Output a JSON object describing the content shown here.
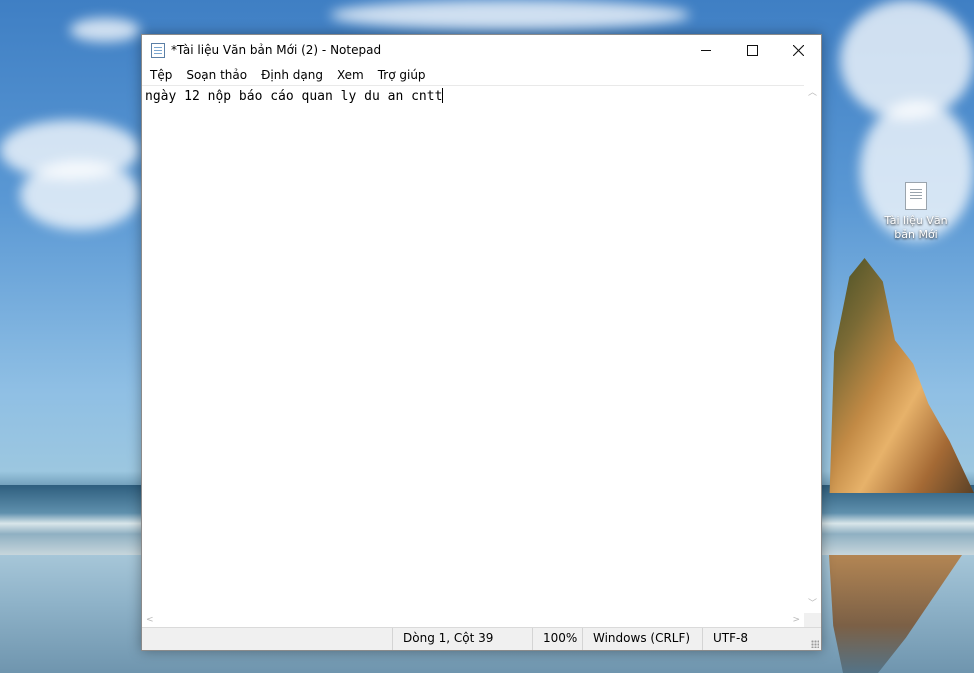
{
  "desktop": {
    "icon": {
      "name": "file-icon",
      "label": "Tài liệu Văn bản Mới"
    }
  },
  "window": {
    "title": "*Tài liệu Văn bản Mới (2) - Notepad",
    "controls": {
      "minimize": "minimize-icon",
      "maximize": "maximize-icon",
      "close": "close-icon"
    }
  },
  "menu": [
    {
      "label": "Tệp"
    },
    {
      "label": "Soạn thảo"
    },
    {
      "label": "Định dạng"
    },
    {
      "label": "Xem"
    },
    {
      "label": "Trợ giúp"
    }
  ],
  "editor": {
    "content": "ngày 12 nộp báo cáo quan ly du an cntt"
  },
  "status": {
    "position": "Dòng 1, Cột 39",
    "zoom": "100%",
    "line_ending": "Windows (CRLF)",
    "encoding": "UTF-8"
  }
}
